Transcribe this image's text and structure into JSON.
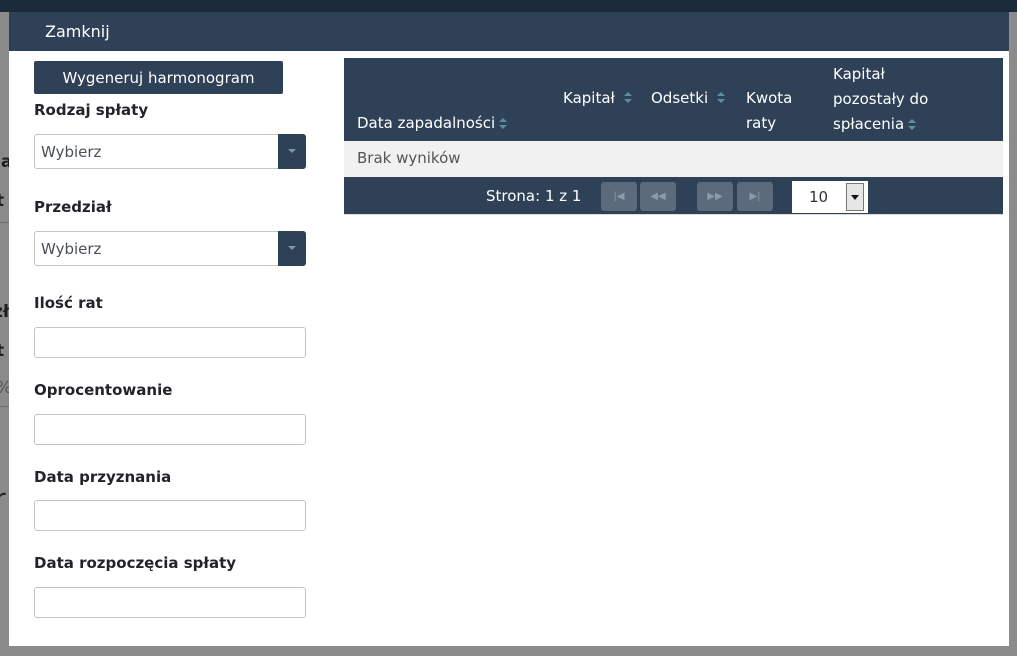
{
  "modal": {
    "close_label": "Zamknij",
    "generate_button": "Wygeneruj harmonogram"
  },
  "form": {
    "repayment_type": {
      "label": "Rodzaj spłaty",
      "value": "Wybierz"
    },
    "interval": {
      "label": "Przedział",
      "value": "Wybierz"
    },
    "installments": {
      "label": "Ilość rat",
      "value": ""
    },
    "interest": {
      "label": "Oprocentowanie",
      "value": ""
    },
    "grant_date": {
      "label": "Data przyznania",
      "value": ""
    },
    "start_date": {
      "label": "Data rozpoczęcia spłaty",
      "value": ""
    }
  },
  "table": {
    "columns": [
      {
        "line1": "",
        "line2": "",
        "line3": "Data zapadalności"
      },
      {
        "line1": "",
        "line2": "Kapitał",
        "line3": ""
      },
      {
        "line1": "",
        "line2": "Odsetki",
        "line3": ""
      },
      {
        "line1": "",
        "line2": "Kwota",
        "line3": "raty"
      },
      {
        "line1": "Kapitał",
        "line2": "pozostały do",
        "line3": "spłacenia"
      }
    ],
    "empty_message": "Brak wyników",
    "paginator": {
      "page_info": "Strona: 1 z 1",
      "first": "|◀",
      "prev": "◀◀",
      "next": "▶▶",
      "last": "▶|",
      "rows_per_page": "10"
    }
  },
  "background": {
    "fragment_1": "ja",
    "fragment_2": "t",
    "fragment_3": "zła",
    "fragment_4": "t",
    "fragment_5": "%",
    "fragment_6": "r"
  },
  "colors": {
    "header": "#2f4157",
    "sort_icon": "#5d8fa3",
    "empty_row": "#f1f1f1"
  }
}
